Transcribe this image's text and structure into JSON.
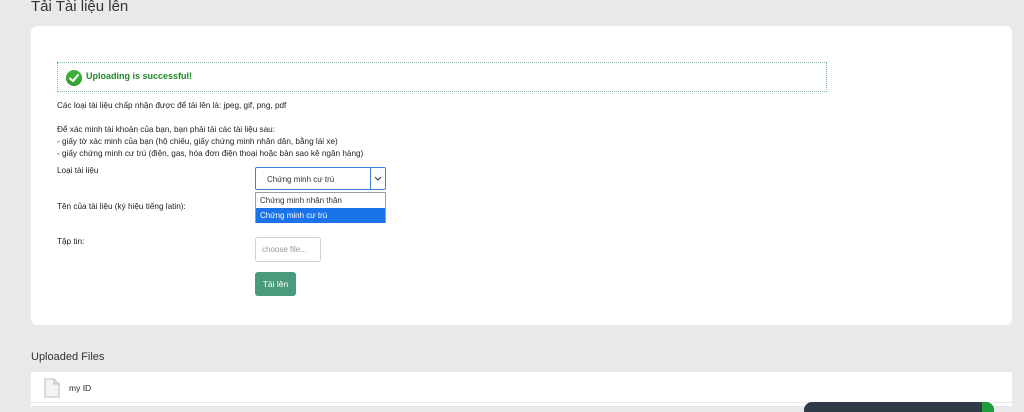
{
  "page": {
    "title": "Tải Tài liệu lên"
  },
  "alert": {
    "message": "Uploading is successful!"
  },
  "info": {
    "accepted_types": "Các loại tài liệu chấp nhận được để tải lên là: jpeg, gif, png, pdf",
    "verify_intro": "Để xác minh tài khoản của bạn, bạn phải tải các tài liệu sau:",
    "req_1": "- giấy tờ xác minh của bạn (hộ chiếu, giấy chứng minh nhân dân, bằng lái xe)",
    "req_2": "- giấy chứng minh cư trú (điện, gas, hóa đơn điện thoại hoặc bản sao kê ngân hàng)"
  },
  "form": {
    "doc_type_label": "Loại tài liệu",
    "doc_type_value": "Chứng minh cư trú",
    "doc_type_options": [
      "Chứng minh nhân thân",
      "Chứng minh cư trú"
    ],
    "doc_name_label": "Tên của tài liệu (ký hiệu tiếng latin):",
    "file_label": "Tập tin:",
    "file_placeholder": "choose file...",
    "submit_label": "Tải lên"
  },
  "uploaded": {
    "title": "Uploaded Files",
    "files": [
      {
        "name": "my ID",
        "icon": "document-icon"
      }
    ]
  },
  "colors": {
    "success": "#1f8a27",
    "button": "#4a9a7c",
    "selected_option": "#1a73e8"
  }
}
